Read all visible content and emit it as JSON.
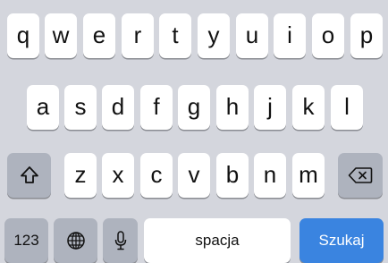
{
  "keyboard": {
    "row1": [
      "q",
      "w",
      "e",
      "r",
      "t",
      "y",
      "u",
      "i",
      "o",
      "p"
    ],
    "row2": [
      "a",
      "s",
      "d",
      "f",
      "g",
      "h",
      "j",
      "k",
      "l"
    ],
    "row3": [
      "z",
      "x",
      "c",
      "v",
      "b",
      "n",
      "m"
    ],
    "bottom": {
      "numbers_label": "123",
      "space_label": "spacja",
      "search_label": "Szukaj"
    },
    "icons": {
      "shift": "shift-icon",
      "delete": "delete-icon",
      "globe": "globe-icon",
      "microphone": "microphone-icon"
    },
    "colors": {
      "background": "#d4d6dd",
      "key": "#ffffff",
      "special_key": "#aeb3be",
      "action_key": "#3a84e0"
    }
  }
}
